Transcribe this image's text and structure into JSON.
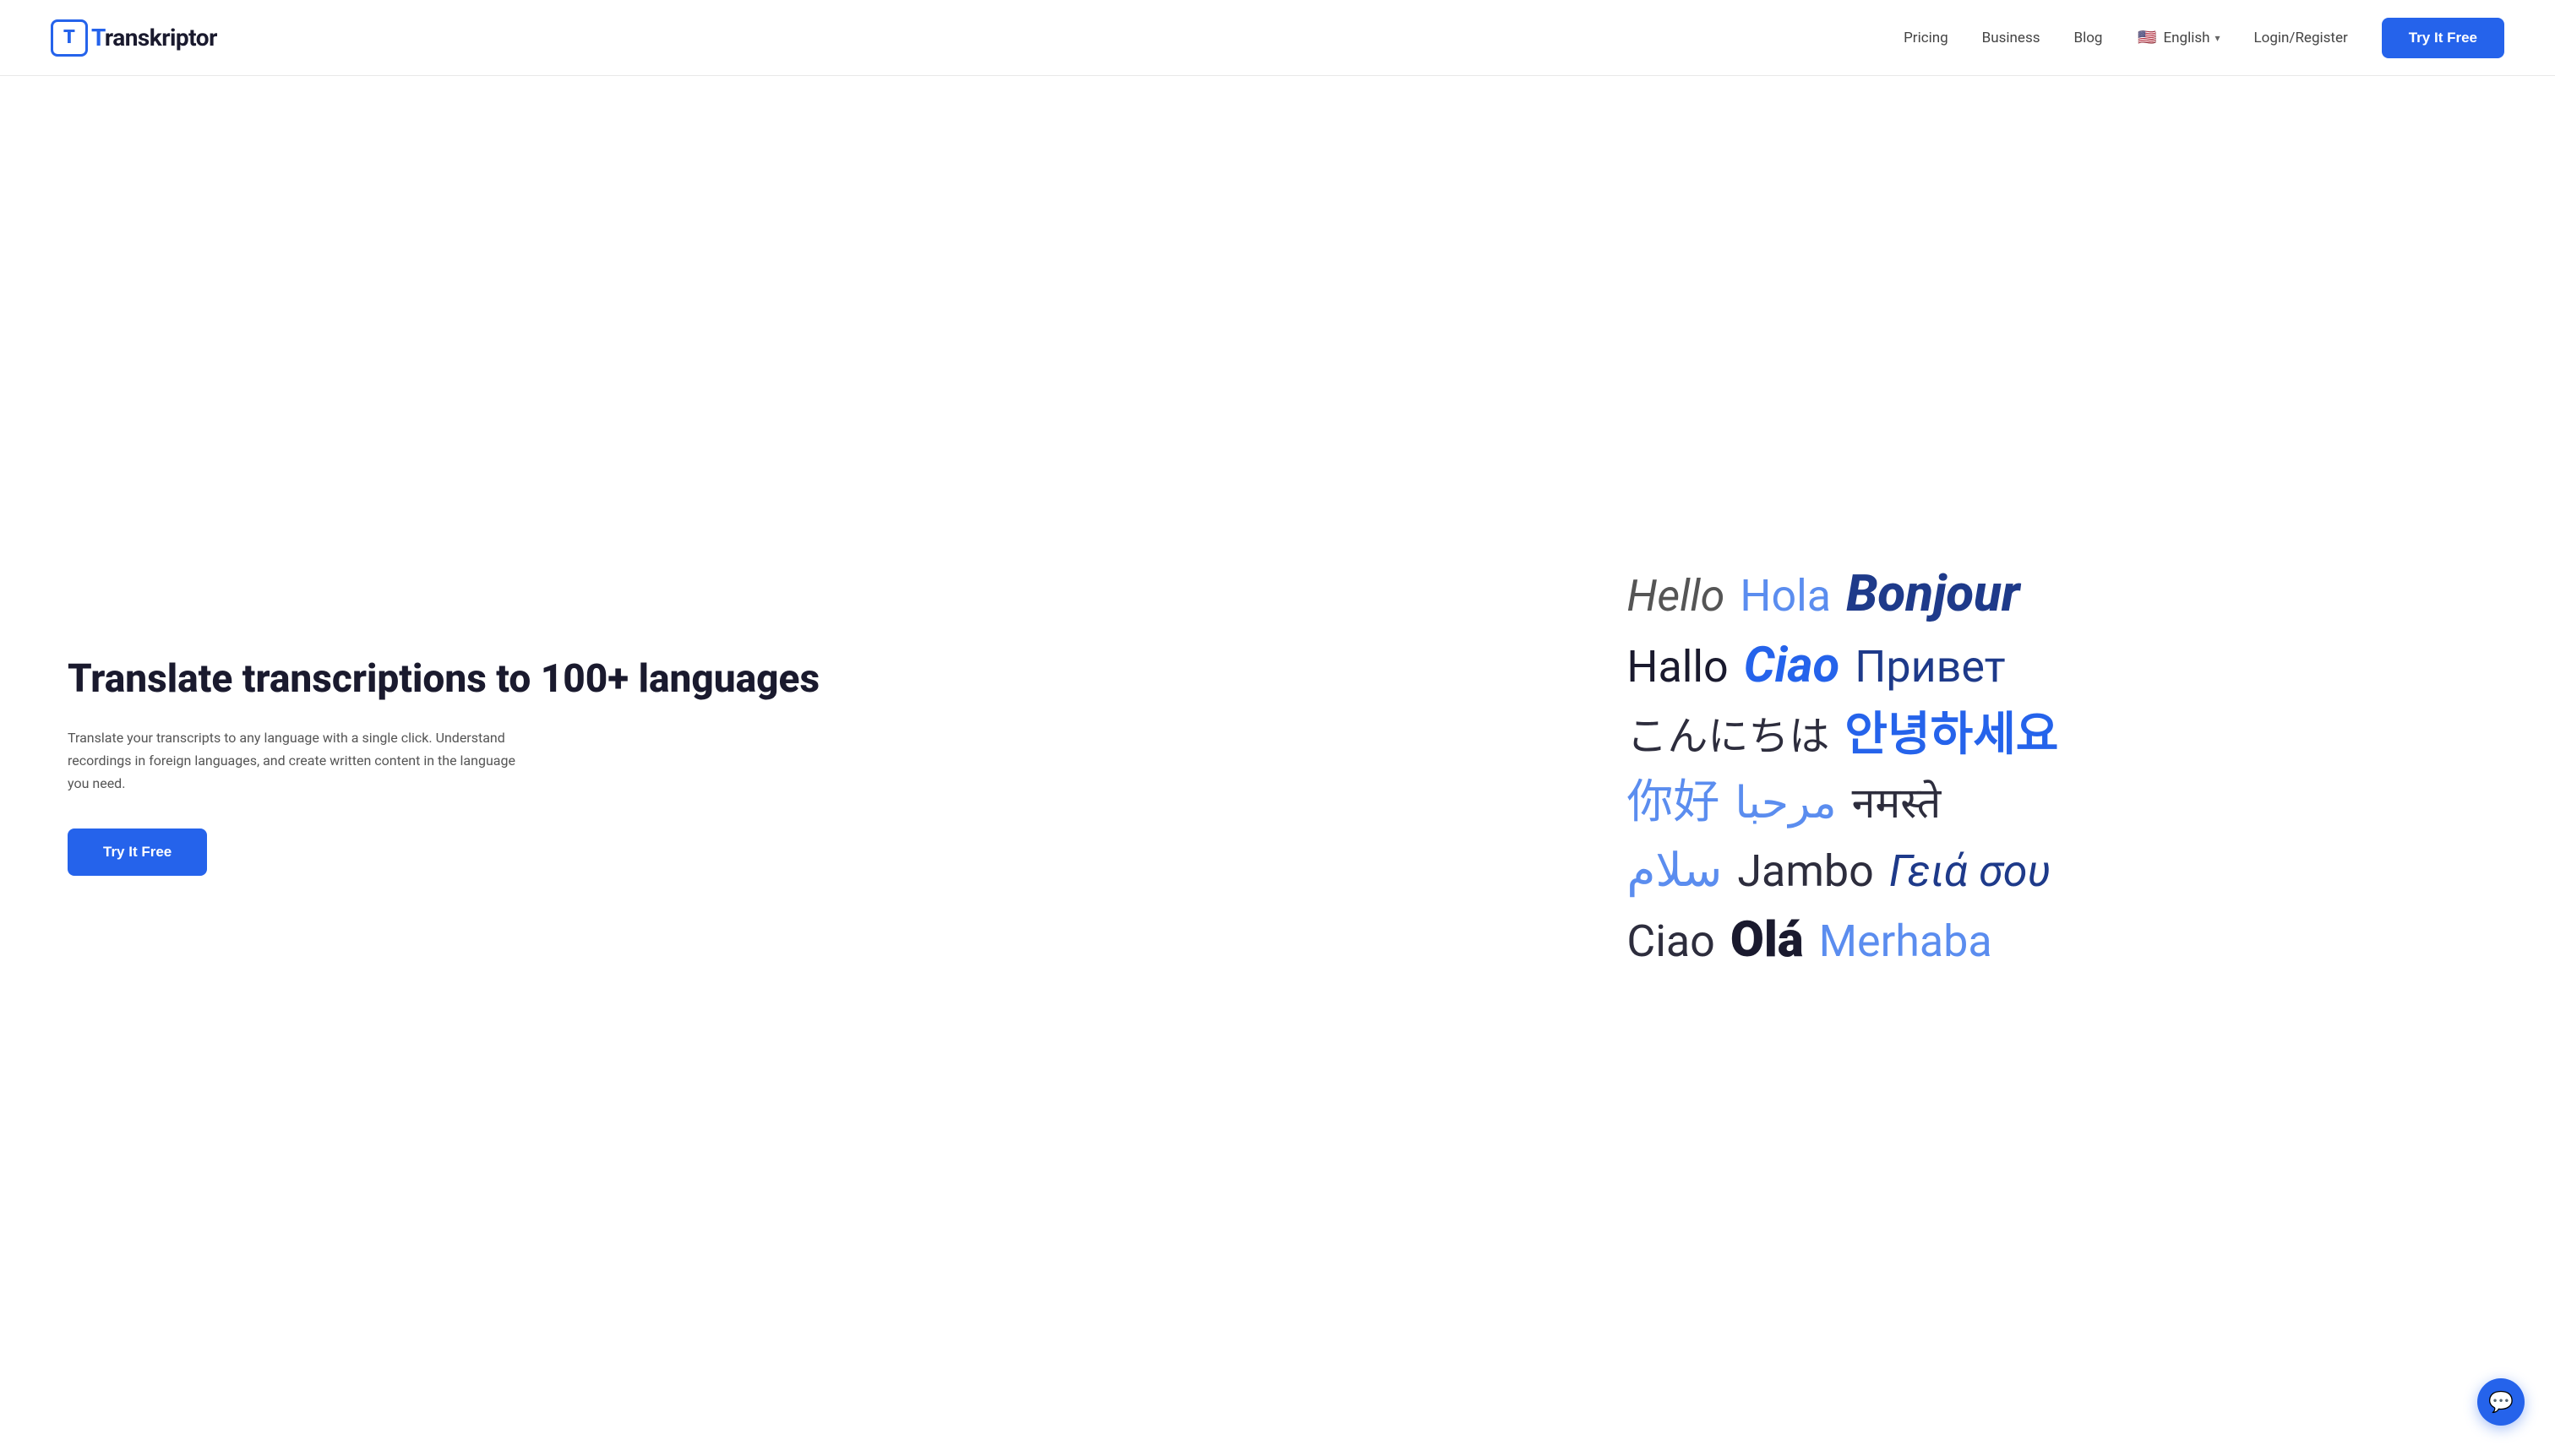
{
  "navbar": {
    "logo_text": "ranskriptor",
    "logo_letter": "T",
    "nav_items": [
      {
        "label": "Pricing",
        "id": "pricing"
      },
      {
        "label": "Business",
        "id": "business"
      },
      {
        "label": "Blog",
        "id": "blog"
      }
    ],
    "language": {
      "flag": "🇺🇸",
      "label": "English",
      "chevron": "▾"
    },
    "login_label": "Login/Register",
    "cta_label": "Try It Free"
  },
  "hero": {
    "title": "Translate transcriptions to 100+ languages",
    "description": "Translate your transcripts to any language with a single click. Understand recordings in foreign languages, and create written content in the language you need.",
    "cta_label": "Try It Free"
  },
  "language_cloud": {
    "rows": [
      [
        {
          "text": "Hello",
          "style": "gray-italic"
        },
        {
          "text": "Hola",
          "style": "blue-normal"
        },
        {
          "text": "Bonjour",
          "style": "darkblue-bold-italic"
        }
      ],
      [
        {
          "text": "Hallo",
          "style": "dark-normal"
        },
        {
          "text": "Ciao",
          "style": "blue-italic-bold"
        },
        {
          "text": "Привет",
          "style": "darkblue-normal"
        }
      ],
      [
        {
          "text": "こんにちは",
          "style": "dark-medium"
        },
        {
          "text": "안녕하세요",
          "style": "blue-bold"
        }
      ],
      [
        {
          "text": "你好",
          "style": "lightblue-normal"
        },
        {
          "text": "مرحبا",
          "style": "blue-arabic"
        },
        {
          "text": "नमस्ते",
          "style": "dark-hindi"
        }
      ],
      [
        {
          "text": "سلام",
          "style": "lightblue-arabic2"
        },
        {
          "text": "Jambo",
          "style": "dark-jambo"
        },
        {
          "text": "Γειά σου",
          "style": "darkblue-greek-italic"
        }
      ],
      [
        {
          "text": "Ciao",
          "style": "dark-ciao2"
        },
        {
          "text": "Olá",
          "style": "darkblue-ola-bold"
        },
        {
          "text": "Merhaba",
          "style": "blue-merhaba"
        }
      ]
    ]
  },
  "chat": {
    "icon": "💬"
  }
}
